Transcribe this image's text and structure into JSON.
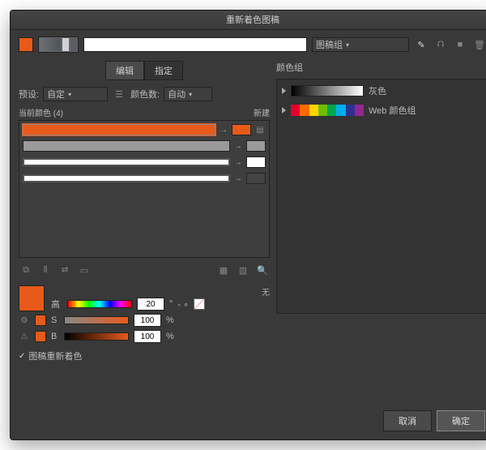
{
  "title": "重新着色图稿",
  "topbar": {
    "dropdown_label": "图稿组"
  },
  "tabs": {
    "edit": "编辑",
    "assign": "指定"
  },
  "preset": {
    "label": "预设:",
    "value": "自定",
    "colorcount_label": "颜色数:",
    "colorcount_value": "自动"
  },
  "currentcolors": {
    "label": "当前颜色 (4)",
    "new_label": "新建",
    "count": 4
  },
  "hsb": {
    "h_label": "高",
    "h_value": "20",
    "s_label": "S",
    "s_value": "100",
    "pct": "%",
    "b_label": "B",
    "b_value": "100",
    "none_label": "无",
    "sep": "°"
  },
  "checkbox": "图稿重新着色",
  "groups": {
    "header": "颜色组",
    "grey": "灰色",
    "web": "Web 颜色组"
  },
  "footer": {
    "cancel": "取消",
    "ok": "确定"
  },
  "webcolors": [
    "#e4002b",
    "#ff6a00",
    "#ffd400",
    "#6bbf00",
    "#00a651",
    "#00aeef",
    "#2e3192",
    "#92278f"
  ]
}
